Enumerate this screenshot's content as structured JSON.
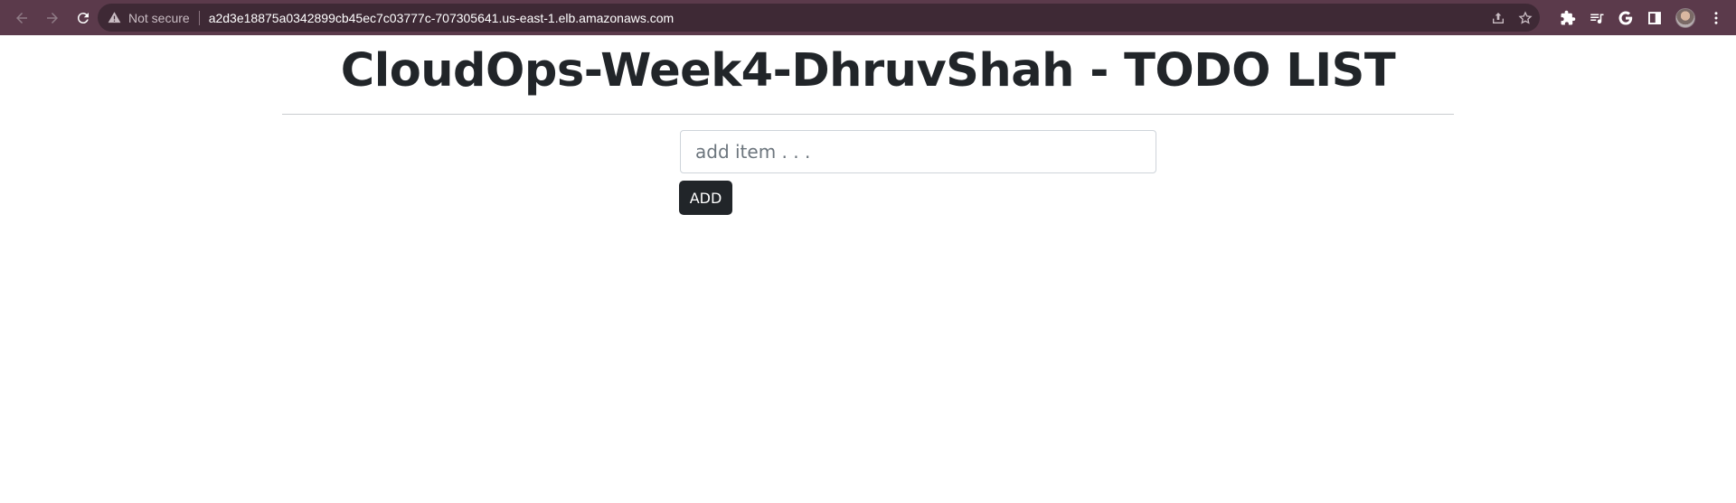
{
  "browser": {
    "security_label": "Not secure",
    "url": "a2d3e18875a0342899cb45ec7c03777c-707305641.us-east-1.elb.amazonaws.com",
    "colors": {
      "frame": "#5b3a4b",
      "omnibox": "#3e2935"
    },
    "icons": [
      "back-arrow-icon",
      "forward-arrow-icon",
      "reload-icon",
      "warning-icon",
      "share-icon",
      "star-icon",
      "extensions-icon",
      "media-controls-icon",
      "google-icon",
      "side-panel-icon",
      "profile-avatar",
      "more-menu-icon"
    ]
  },
  "page": {
    "title": "CloudOps-Week4-DhruvShah - TODO LIST",
    "input_placeholder": "add item . . .",
    "input_value": "",
    "add_button_label": "ADD",
    "colors": {
      "button_bg": "#212529",
      "text": "#212529"
    }
  }
}
